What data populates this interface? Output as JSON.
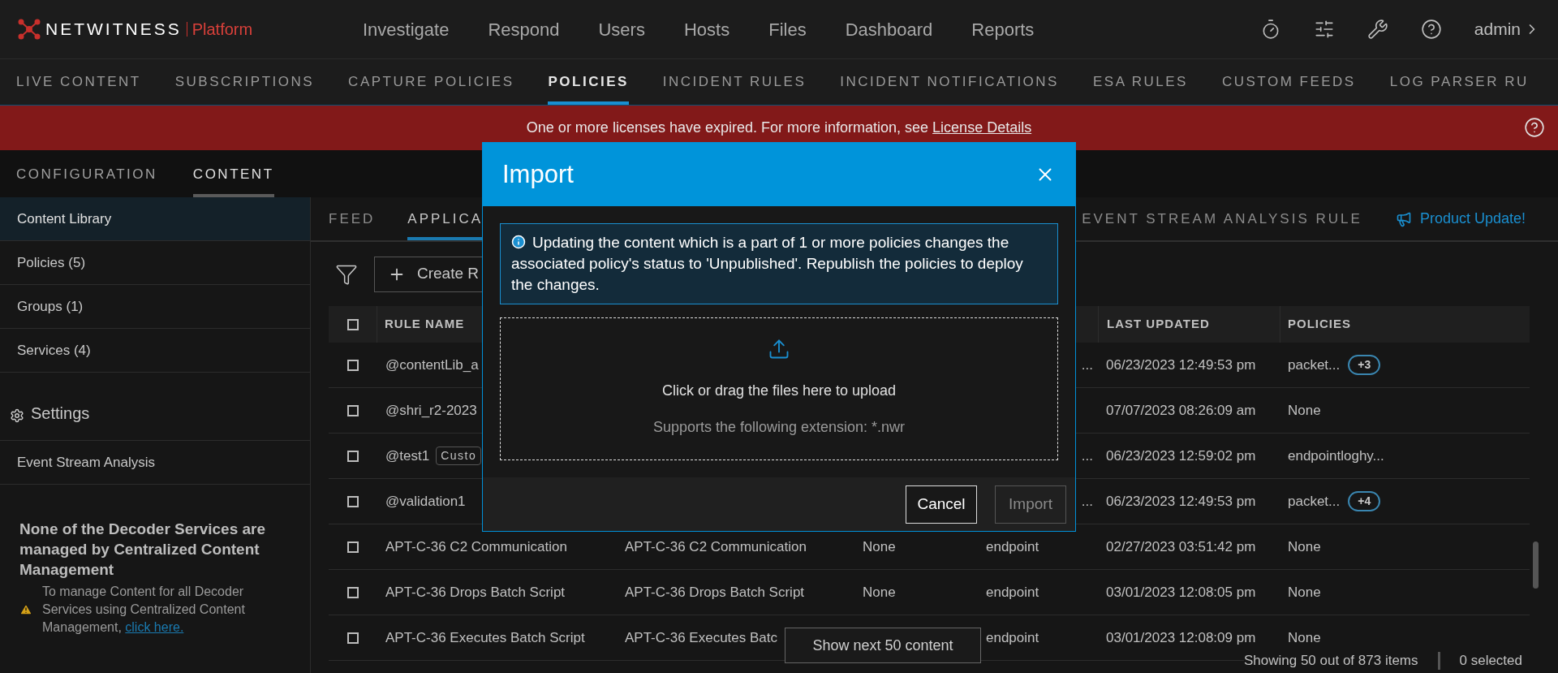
{
  "header": {
    "brand": "NETWITNESS",
    "product": "Platform",
    "user": "admin"
  },
  "top_nav": [
    {
      "label": "Investigate"
    },
    {
      "label": "Respond"
    },
    {
      "label": "Users"
    },
    {
      "label": "Hosts"
    },
    {
      "label": "Files"
    },
    {
      "label": "Dashboard"
    },
    {
      "label": "Reports"
    }
  ],
  "sub_nav": [
    {
      "label": "LIVE CONTENT",
      "selected": false
    },
    {
      "label": "SUBSCRIPTIONS",
      "selected": false
    },
    {
      "label": "CAPTURE POLICIES",
      "selected": false
    },
    {
      "label": "POLICIES",
      "selected": true
    },
    {
      "label": "INCIDENT RULES",
      "selected": false
    },
    {
      "label": "INCIDENT NOTIFICATIONS",
      "selected": false
    },
    {
      "label": "ESA RULES",
      "selected": false
    },
    {
      "label": "CUSTOM FEEDS",
      "selected": false
    },
    {
      "label": "LOG PARSER RU",
      "selected": false
    }
  ],
  "banner": {
    "text": "One or more licenses have expired. For more information, see",
    "link": "License Details"
  },
  "section_tabs": [
    {
      "label": "CONFIGURATION",
      "selected": false
    },
    {
      "label": "CONTENT",
      "selected": true
    }
  ],
  "sidebar": {
    "items": [
      {
        "label": "Content Library",
        "selected": true
      },
      {
        "label": "Policies (5)",
        "selected": false
      },
      {
        "label": "Groups (1)",
        "selected": false
      },
      {
        "label": "Services (4)",
        "selected": false
      }
    ],
    "settings_heading": "Settings",
    "settings_items": [
      {
        "label": "Event Stream Analysis",
        "selected": false
      }
    ],
    "notice": {
      "title": "None of the Decoder Services are managed by Centralized Content Management",
      "text": "To manage Content for all Decoder Services using Centralized Content Management,",
      "link": "click here."
    }
  },
  "content_tabs": [
    {
      "label": "FEED",
      "selected": false
    },
    {
      "label": "APPLICA",
      "selected": true
    },
    {
      "label": "EVENT STREAM ANALYSIS RULE",
      "selected": false
    }
  ],
  "product_update": "Product Update!",
  "toolbar": {
    "create_button": "Create R"
  },
  "table": {
    "select_all_checked": false,
    "header": {
      "rule_name": "RULE NAME",
      "last_updated": "LAST UPDATED",
      "policies": "POLICIES"
    },
    "rows": [
      {
        "checked": false,
        "rule_name": "@contentLib_a",
        "column_4_tail": "...",
        "last_updated": "06/23/2023 12:49:53 pm",
        "policies": "packet...",
        "policies_more": "+3"
      },
      {
        "checked": false,
        "rule_name": "@shri_r2-2023",
        "last_updated": "07/07/2023 08:26:09 am",
        "policies": "None"
      },
      {
        "checked": false,
        "rule_name": "@test1",
        "tag": "Custo",
        "column_4_tail": "...",
        "last_updated": "06/23/2023 12:59:02 pm",
        "policies": "endpointloghy..."
      },
      {
        "checked": false,
        "rule_name": "@validation1",
        "column_4_tail": "...",
        "last_updated": "06/23/2023 12:49:53 pm",
        "policies": "packet...",
        "policies_more": "+4"
      },
      {
        "checked": false,
        "rule_name": "APT-C-36 C2 Communication",
        "column_2": "APT-C-36 C2 Communication",
        "column_3": "None",
        "column_4": "endpoint",
        "last_updated": "02/27/2023 03:51:42 pm",
        "policies": "None"
      },
      {
        "checked": false,
        "rule_name": "APT-C-36 Drops Batch Script",
        "column_2": "APT-C-36 Drops Batch Script",
        "column_3": "None",
        "column_4": "endpoint",
        "last_updated": "03/01/2023 12:08:05 pm",
        "policies": "None"
      },
      {
        "checked": false,
        "rule_name": "APT-C-36 Executes Batch Script",
        "column_2": "APT-C-36 Executes Batc",
        "column_4": "endpoint",
        "last_updated": "03/01/2023 12:08:09 pm",
        "policies": "None"
      }
    ],
    "show_more": "Show next 50 content",
    "status": "Showing 50 out of 873 items",
    "selected_count": "0 selected"
  },
  "dialog": {
    "title": "Import",
    "alert": "Updating the content which is a part of 1 or more policies changes the associated policy's status to 'Unpublished'. Republish the policies to deploy the changes.",
    "drop_text": "Click or drag the files here to upload",
    "drop_hint": "Supports the following extension: *.nwr",
    "buttons": [
      {
        "label": "Cancel",
        "disabled": false
      },
      {
        "label": "Import",
        "disabled": true
      }
    ]
  }
}
